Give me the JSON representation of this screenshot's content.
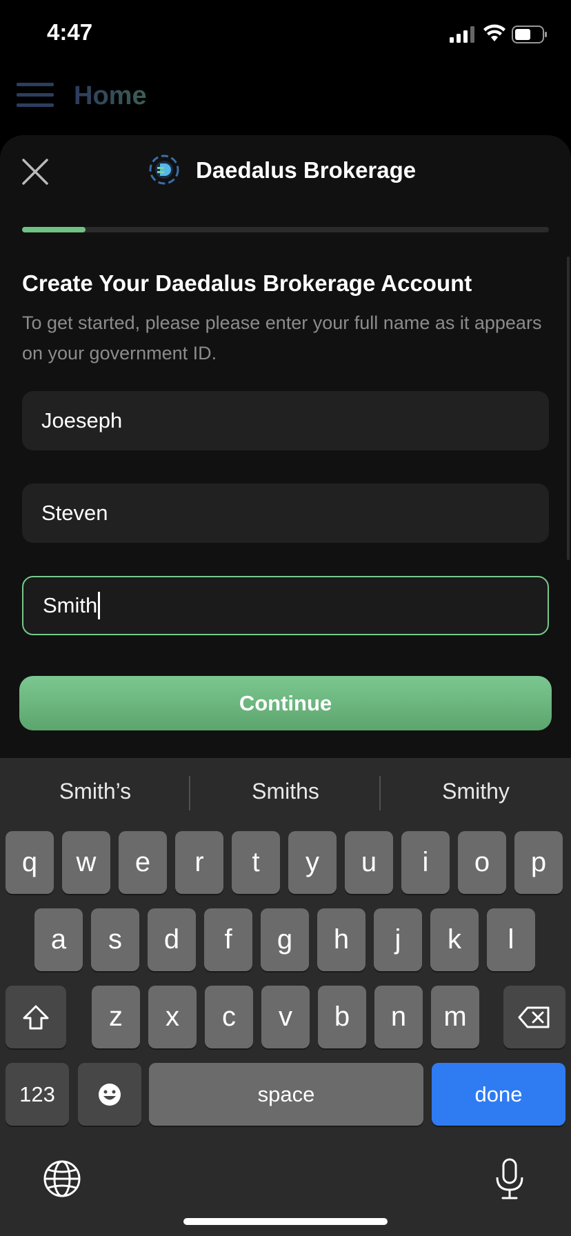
{
  "status_bar": {
    "time": "4:47"
  },
  "background_app": {
    "title": "Home"
  },
  "sheet": {
    "title": "Daedalus Brokerage",
    "progress": 0.12,
    "heading": "Create Your Daedalus Brokerage Account",
    "subtext": "To get started, please please enter your full name as it appears on your government ID.",
    "fields": [
      {
        "value": "Joeseph",
        "focused": false
      },
      {
        "value": "Steven",
        "focused": false
      },
      {
        "value": "Smith",
        "focused": true
      }
    ],
    "continue_label": "Continue"
  },
  "colors": {
    "accent": "#78c98c",
    "done_key": "#2f7bf2"
  },
  "keyboard": {
    "suggestions": [
      "Smith’s",
      "Smiths",
      "Smithy"
    ],
    "row1": [
      "q",
      "w",
      "e",
      "r",
      "t",
      "y",
      "u",
      "i",
      "o",
      "p"
    ],
    "row2": [
      "a",
      "s",
      "d",
      "f",
      "g",
      "h",
      "j",
      "k",
      "l"
    ],
    "row3": [
      "z",
      "x",
      "c",
      "v",
      "b",
      "n",
      "m"
    ],
    "numbers_label": "123",
    "space_label": "space",
    "done_label": "done",
    "icons": {
      "shift": "shift-icon",
      "delete": "delete-icon",
      "emoji": "emoji-icon",
      "globe": "globe-icon",
      "mic": "microphone-icon"
    }
  }
}
